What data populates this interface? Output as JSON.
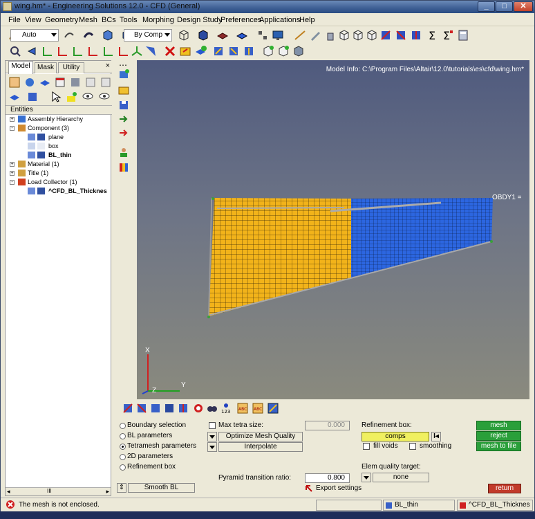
{
  "window": {
    "title": "wing.hm* - Engineering Solutions 12.0 - CFD (General)",
    "controls": {
      "minimize": "_",
      "maximize": "□",
      "close": "✕"
    }
  },
  "menu": [
    "File",
    "View",
    "Geometry",
    "Mesh",
    "BCs",
    "Tools",
    "Morphing",
    "Design Study",
    "Preferences",
    "Applications",
    "Help"
  ],
  "toolbar": {
    "auto_combo": "Auto",
    "bycomp_combo": "By Comp"
  },
  "left_panel": {
    "tabs": [
      "Model",
      "Mask",
      "Utility"
    ],
    "close": "×",
    "entities_label": "Entities",
    "tree": [
      {
        "label": "Assembly Hierarchy",
        "level": 0,
        "expander": "+"
      },
      {
        "label": "Component (3)",
        "level": 0,
        "expander": "-"
      },
      {
        "label": "plane",
        "level": 1
      },
      {
        "label": "box",
        "level": 1
      },
      {
        "label": "BL_thin",
        "level": 1,
        "bold": true
      },
      {
        "label": "Material (1)",
        "level": 0,
        "expander": "+"
      },
      {
        "label": "Title (1)",
        "level": 0,
        "expander": "+"
      },
      {
        "label": "Load Collector (1)",
        "level": 0,
        "expander": "-"
      },
      {
        "label": "^CFD_BL_Thicknes",
        "level": 1,
        "bold": true
      }
    ],
    "scroll_thumb": "III"
  },
  "viewport": {
    "model_info": "Model Info: C:\\Program Files\\Altair\\12.0\\tutorials\\es\\cfd\\wing.hm*",
    "node_label": "OBDY1 =",
    "axes": {
      "x": "X",
      "y": "Y",
      "z": "Z"
    },
    "colors": {
      "yellow": "#f2b31a",
      "blue": "#2c66e0"
    }
  },
  "tetramesh_panel": {
    "radio_options": [
      {
        "label": "Boundary selection",
        "selected": false
      },
      {
        "label": "BL parameters",
        "selected": false
      },
      {
        "label": "Tetramesh parameters",
        "selected": true
      },
      {
        "label": "2D parameters",
        "selected": false
      },
      {
        "label": "Refinement box",
        "selected": false
      }
    ],
    "max_tetra_label": "Max tetra size:",
    "max_tetra_value": "0.000",
    "optimize_button": "Optimize Mesh Quality",
    "interpolate_button": "Interpolate",
    "pyramid_label": "Pyramid transition ratio:",
    "pyramid_value": "0.800",
    "export_settings": "Export settings",
    "refinement_box_label": "Refinement box:",
    "comps_button": "comps",
    "fill_voids_label": "fill voids",
    "smoothing_label": "smoothing",
    "elem_quality_label": "Elem quality target:",
    "elem_quality_value": "none",
    "smooth_bl_button": "Smooth BL",
    "mesh_button": "mesh",
    "reject_button": "reject",
    "mesh_to_file_button": "mesh to file",
    "return_button": "return"
  },
  "status": {
    "message": "The mesh is not enclosed.",
    "component": "BL_thin",
    "load_collector": "^CFD_BL_Thicknes"
  }
}
